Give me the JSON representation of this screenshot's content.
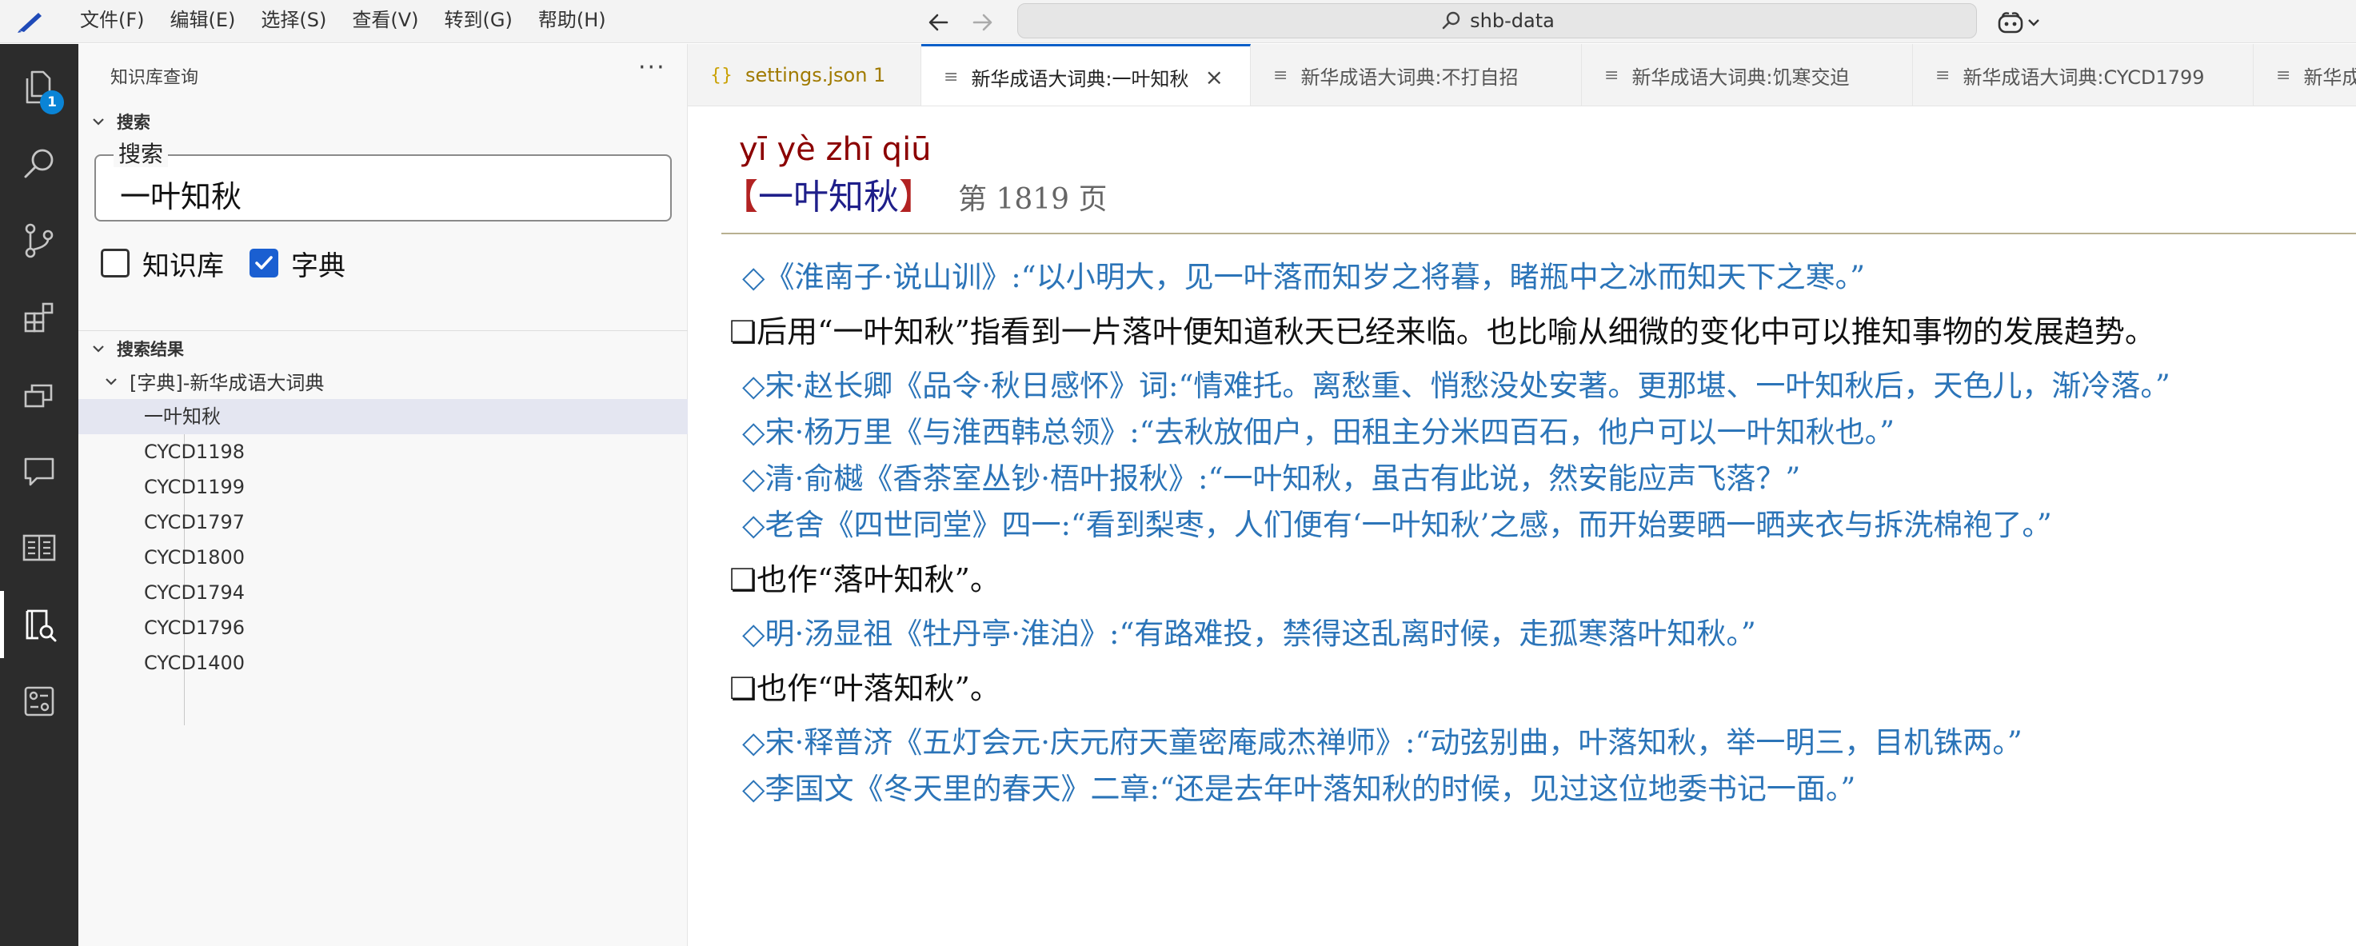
{
  "menubar": {
    "items": [
      "文件(F)",
      "编辑(E)",
      "选择(S)",
      "查看(V)",
      "转到(G)",
      "帮助(H)"
    ]
  },
  "titlebar": {
    "search_text": "shb-data"
  },
  "activitybar": {
    "explorer_badge": "1"
  },
  "sidebar": {
    "title": "知识库查询",
    "more": "···",
    "search_section": "搜索",
    "search_legend": "搜索",
    "search_value": "一叶知秋",
    "checkbox_kb": {
      "label": "知识库",
      "checked": false
    },
    "checkbox_dict": {
      "label": "字典",
      "checked": true
    },
    "results_section": "搜索结果",
    "group_label": "[字典]-新华成语大词典",
    "results": [
      "一叶知秋",
      "CYCD1198",
      "CYCD1199",
      "CYCD1797",
      "CYCD1800",
      "CYCD1794",
      "CYCD1796",
      "CYCD1400"
    ]
  },
  "tabs": [
    {
      "icon": "{}",
      "label": "settings.json 1"
    },
    {
      "icon": "≡",
      "label": "新华成语大词典:一叶知秋",
      "close": "×"
    },
    {
      "icon": "≡",
      "label": "新华成语大词典:不打自招"
    },
    {
      "icon": "≡",
      "label": "新华成语大词典:饥寒交迫"
    },
    {
      "icon": "≡",
      "label": "新华成语大词典:CYCD1799"
    },
    {
      "icon": "≡",
      "label": "新华成"
    }
  ],
  "entry": {
    "pinyin": "yī yè zhī qiū",
    "bracket_open": "【",
    "word": "一叶知秋",
    "bracket_close": "】",
    "page": "第 1819 页",
    "lines": [
      "◇《淮南子·说山训》:“以小明大，见一叶落而知岁之将暮，睹瓶中之冰而知天下之寒。”",
      "❏后用“一叶知秋”指看到一片落叶便知道秋天已经来临。也比喻从细微的变化中可以推知事物的发展趋势。",
      "◇宋·赵长卿《品令·秋日感怀》词:“情难托。离愁重、悄愁没处安著。更那堪、一叶知秋后，天色儿，渐冷落。”",
      "◇宋·杨万里《与淮西韩总领》:“去秋放佃户，田租主分米四百石，他户可以一叶知秋也。”",
      "◇清·俞樾《香茶室丛钞·梧叶报秋》:“一叶知秋，虽古有此说，然安能应声飞落？”",
      "◇老舍《四世同堂》四一:“看到梨枣，人们便有‘一叶知秋’之感，而开始要晒一晒夹衣与拆洗棉袍了。”",
      "❏也作“落叶知秋”。",
      "◇明·汤显祖《牡丹亭·淮泊》:“有路难投，禁得这乱离时候，走孤寒落叶知秋。”",
      "❏也作“叶落知秋”。",
      "◇宋·释普济《五灯会元·庆元府天童密庵咸杰禅师》:“动弦别曲，叶落知秋，举一明三，目机铢两。”",
      "◇李国文《冬天里的春天》二章:“还是去年叶落知秋的时候，见过这位地委书记一面。”"
    ]
  }
}
